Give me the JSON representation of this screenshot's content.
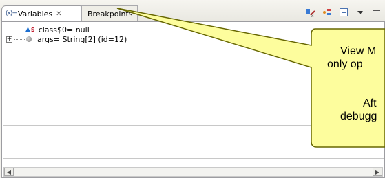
{
  "tabs": [
    {
      "label": "Variables",
      "icon": "(x)=",
      "close": "✕"
    },
    {
      "label": "Breakpoints"
    }
  ],
  "toolbar_icons": [
    "show-type-names-icon",
    "show-logical-structure-icon",
    "collapse-all-icon",
    "view-menu-icon",
    "minimize-icon"
  ],
  "variables": [
    {
      "name": "class$0= null",
      "marker": "S"
    },
    {
      "name": "args= String[2]  (id=12)",
      "expander": "+"
    }
  ],
  "callout": {
    "line1": "View M",
    "line2": "only op",
    "line3": "Aft",
    "line4": "debugg",
    "fill": "#fdfd9d",
    "stroke": "#666600"
  },
  "scrollbar": {
    "left": "◀",
    "right": "▶"
  }
}
